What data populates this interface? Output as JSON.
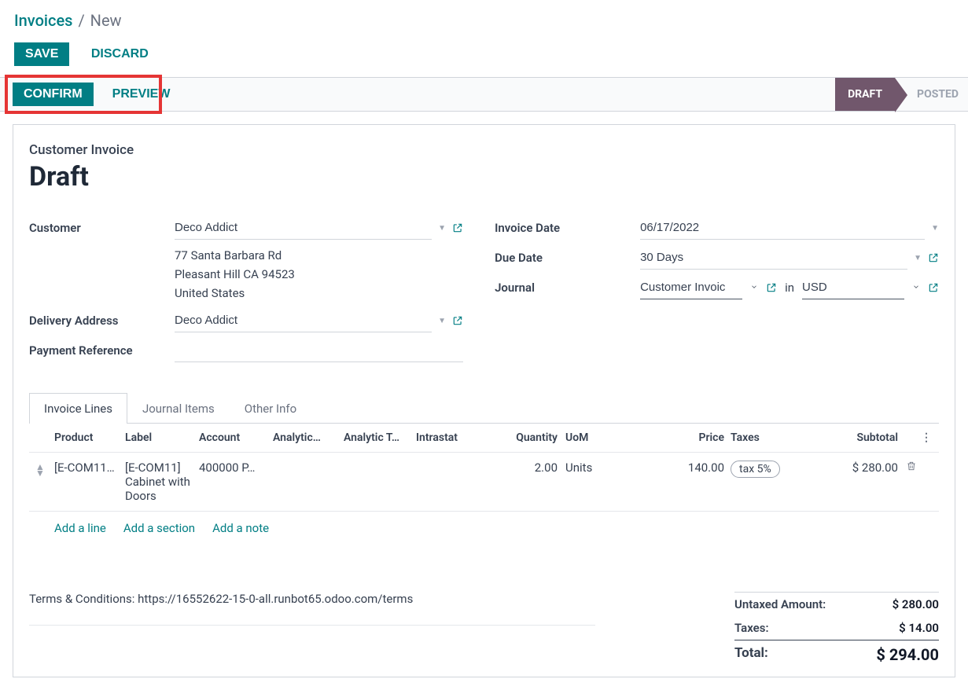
{
  "breadcrumb": {
    "root": "Invoices",
    "sep": "/",
    "current": "New"
  },
  "toolbar": {
    "save": "SAVE",
    "discard": "DISCARD"
  },
  "statusbar": {
    "confirm": "CONFIRM",
    "preview": "PREVIEW",
    "stage_draft": "DRAFT",
    "stage_posted": "POSTED"
  },
  "header": {
    "type": "Customer Invoice",
    "title": "Draft"
  },
  "left": {
    "customer_label": "Customer",
    "customer": "Deco Addict",
    "addr1": "77 Santa Barbara Rd",
    "addr2": "Pleasant Hill CA 94523",
    "addr3": "United States",
    "delivery_label": "Delivery Address",
    "delivery": "Deco Addict",
    "payref_label": "Payment Reference",
    "payref": ""
  },
  "right": {
    "invoice_date_label": "Invoice Date",
    "invoice_date": "06/17/2022",
    "due_date_label": "Due Date",
    "due_date": "30 Days",
    "journal_label": "Journal",
    "journal": "Customer Invoic",
    "journal_mid": "in",
    "currency": "USD"
  },
  "tabs": {
    "t1": "Invoice Lines",
    "t2": "Journal Items",
    "t3": "Other Info"
  },
  "columns": {
    "product": "Product",
    "label": "Label",
    "account": "Account",
    "analytic": "Analytic…",
    "analytict": "Analytic T…",
    "intrastat": "Intrastat",
    "qty": "Quantity",
    "uom": "UoM",
    "price": "Price",
    "taxes": "Taxes",
    "subtotal": "Subtotal"
  },
  "rows": [
    {
      "product": "[E-COM11…",
      "label": "[E-COM11] Cabinet with Doors",
      "account": "400000 P…",
      "qty": "2.00",
      "uom": "Units",
      "price": "140.00",
      "tax": "tax 5%",
      "subtotal": "$ 280.00"
    }
  ],
  "addlinks": {
    "line": "Add a line",
    "section": "Add a section",
    "note": "Add a note"
  },
  "terms": "Terms & Conditions: https://16552622-15-0-all.runbot65.odoo.com/terms",
  "totals": {
    "untaxed_l": "Untaxed Amount:",
    "untaxed_v": "$ 280.00",
    "taxes_l": "Taxes:",
    "taxes_v": "$ 14.00",
    "total_l": "Total:",
    "total_v": "$ 294.00"
  }
}
